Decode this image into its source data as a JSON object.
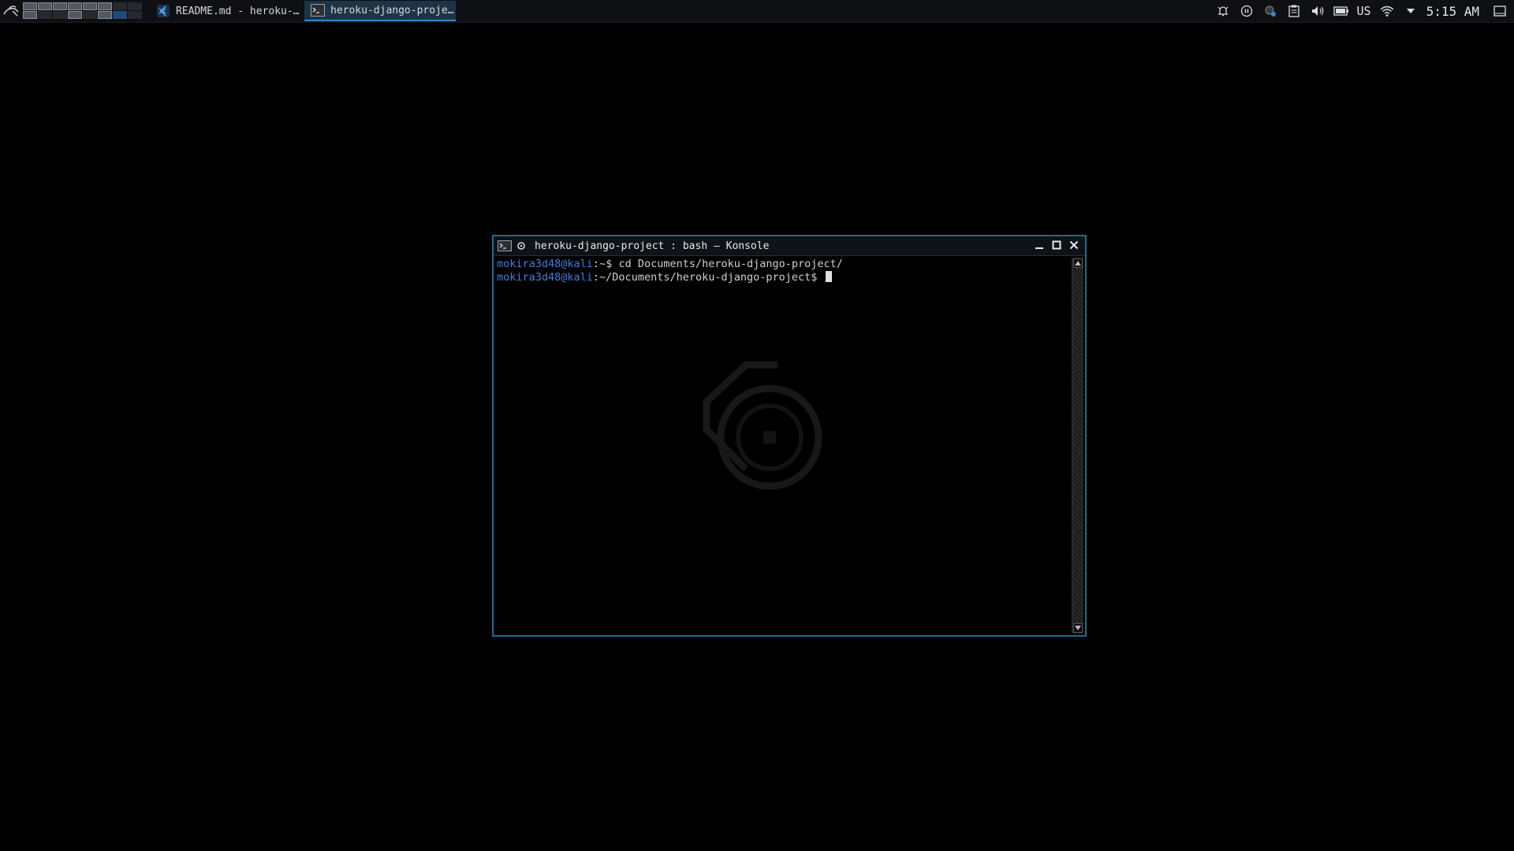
{
  "panel": {
    "taskbar": [
      {
        "label": "README.md - heroku-…",
        "icon": "vscode-icon",
        "active": false
      },
      {
        "label": "heroku-django-proje…",
        "icon": "terminal-icon",
        "active": true
      }
    ],
    "tray": {
      "keyboard_layout": "US",
      "clock": "5:15 AM",
      "icons": [
        "notifications-icon",
        "media-pause-icon",
        "network-manager-icon",
        "clipboard-icon",
        "volume-icon",
        "battery-icon",
        "wifi-icon",
        "tray-expand-icon",
        "show-desktop-icon"
      ]
    }
  },
  "window": {
    "title": "heroku-django-project : bash — Konsole",
    "terminal": {
      "lines": [
        {
          "user": "mokira3d48@kali",
          "path": ":~",
          "prompt": "$ ",
          "command": "cd Documents/heroku-django-project/"
        },
        {
          "user": "mokira3d48@kali",
          "path": ":~/Documents/heroku-django-project",
          "prompt": "$ ",
          "command": ""
        }
      ]
    }
  },
  "colors": {
    "accent": "#1f6a97",
    "prompt_user": "#3f7fe0",
    "background": "#000000"
  }
}
